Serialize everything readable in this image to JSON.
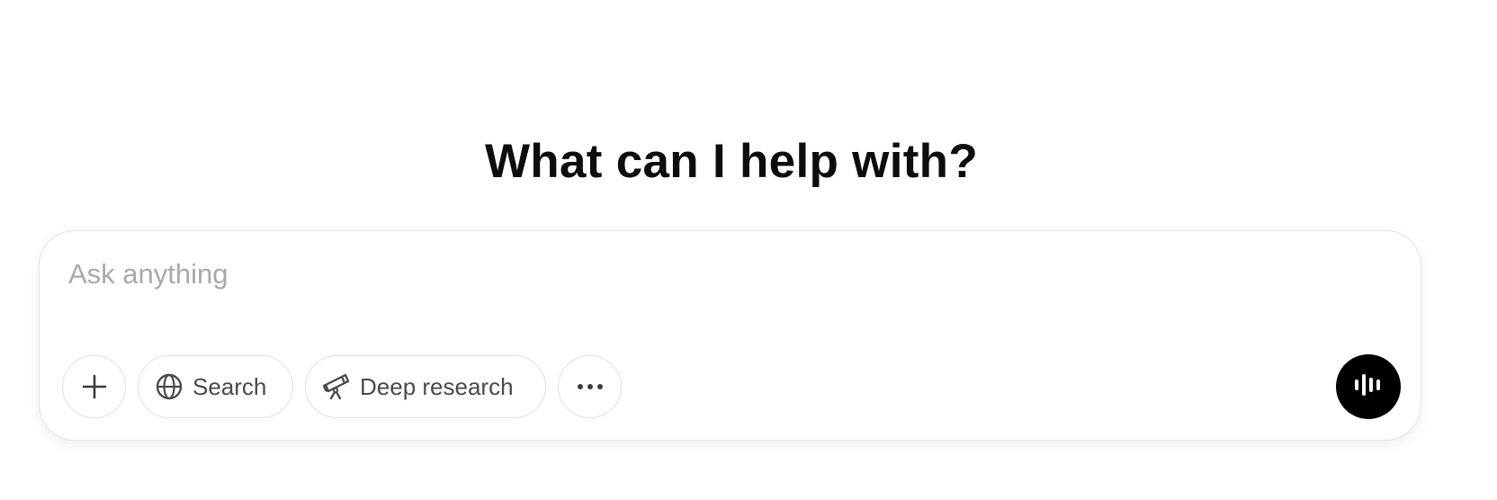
{
  "heading": "What can I help with?",
  "composer": {
    "placeholder": "Ask anything",
    "value": "",
    "buttons": {
      "attach": {
        "icon": "plus-icon"
      },
      "search": {
        "label": "Search",
        "icon": "globe-icon"
      },
      "deep_research": {
        "label": "Deep research",
        "icon": "telescope-icon"
      },
      "more": {
        "icon": "ellipsis-icon"
      },
      "voice": {
        "icon": "voice-wave-icon"
      }
    }
  },
  "colors": {
    "text": "#0d0d0d",
    "placeholder": "#a9a9a9",
    "border": "#e3e3e3",
    "voice_button": "#000000",
    "pill_text": "#4a4a4a"
  }
}
